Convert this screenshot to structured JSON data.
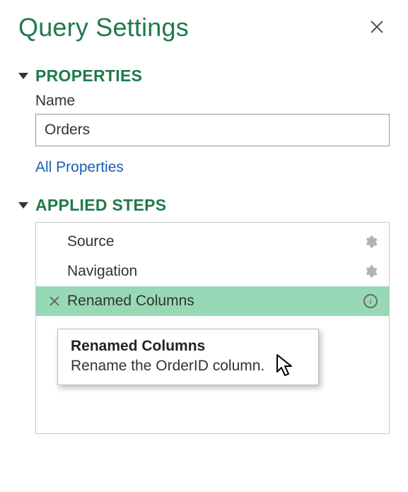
{
  "header": {
    "title": "Query Settings"
  },
  "properties": {
    "section_title": "PROPERTIES",
    "name_label": "Name",
    "name_value": "Orders",
    "all_properties_link": "All Properties"
  },
  "applied_steps": {
    "section_title": "APPLIED STEPS",
    "steps": [
      {
        "label": "Source",
        "selected": false,
        "has_gear": true,
        "has_info": false
      },
      {
        "label": "Navigation",
        "selected": false,
        "has_gear": true,
        "has_info": false
      },
      {
        "label": "Renamed Columns",
        "selected": true,
        "has_gear": false,
        "has_info": true
      }
    ]
  },
  "tooltip": {
    "title": "Renamed Columns",
    "description": "Rename the OrderID column."
  }
}
